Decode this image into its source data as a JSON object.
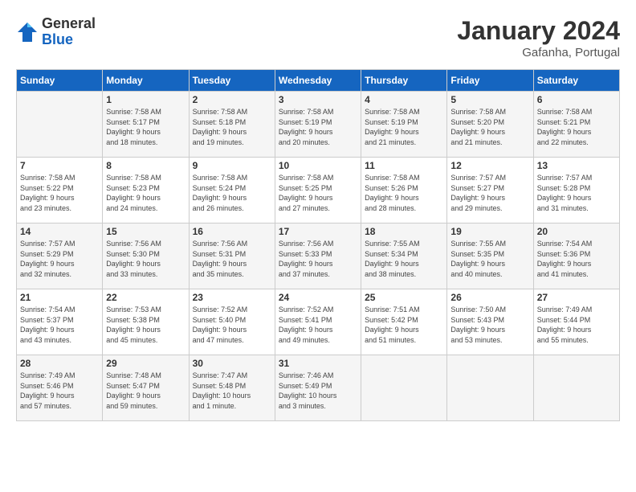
{
  "header": {
    "logo": {
      "line1": "General",
      "line2": "Blue"
    },
    "title": "January 2024",
    "location": "Gafanha, Portugal"
  },
  "weekdays": [
    "Sunday",
    "Monday",
    "Tuesday",
    "Wednesday",
    "Thursday",
    "Friday",
    "Saturday"
  ],
  "weeks": [
    [
      {
        "day": "",
        "info": ""
      },
      {
        "day": "1",
        "info": "Sunrise: 7:58 AM\nSunset: 5:17 PM\nDaylight: 9 hours\nand 18 minutes."
      },
      {
        "day": "2",
        "info": "Sunrise: 7:58 AM\nSunset: 5:18 PM\nDaylight: 9 hours\nand 19 minutes."
      },
      {
        "day": "3",
        "info": "Sunrise: 7:58 AM\nSunset: 5:19 PM\nDaylight: 9 hours\nand 20 minutes."
      },
      {
        "day": "4",
        "info": "Sunrise: 7:58 AM\nSunset: 5:19 PM\nDaylight: 9 hours\nand 21 minutes."
      },
      {
        "day": "5",
        "info": "Sunrise: 7:58 AM\nSunset: 5:20 PM\nDaylight: 9 hours\nand 21 minutes."
      },
      {
        "day": "6",
        "info": "Sunrise: 7:58 AM\nSunset: 5:21 PM\nDaylight: 9 hours\nand 22 minutes."
      }
    ],
    [
      {
        "day": "7",
        "info": "Sunrise: 7:58 AM\nSunset: 5:22 PM\nDaylight: 9 hours\nand 23 minutes."
      },
      {
        "day": "8",
        "info": "Sunrise: 7:58 AM\nSunset: 5:23 PM\nDaylight: 9 hours\nand 24 minutes."
      },
      {
        "day": "9",
        "info": "Sunrise: 7:58 AM\nSunset: 5:24 PM\nDaylight: 9 hours\nand 26 minutes."
      },
      {
        "day": "10",
        "info": "Sunrise: 7:58 AM\nSunset: 5:25 PM\nDaylight: 9 hours\nand 27 minutes."
      },
      {
        "day": "11",
        "info": "Sunrise: 7:58 AM\nSunset: 5:26 PM\nDaylight: 9 hours\nand 28 minutes."
      },
      {
        "day": "12",
        "info": "Sunrise: 7:57 AM\nSunset: 5:27 PM\nDaylight: 9 hours\nand 29 minutes."
      },
      {
        "day": "13",
        "info": "Sunrise: 7:57 AM\nSunset: 5:28 PM\nDaylight: 9 hours\nand 31 minutes."
      }
    ],
    [
      {
        "day": "14",
        "info": "Sunrise: 7:57 AM\nSunset: 5:29 PM\nDaylight: 9 hours\nand 32 minutes."
      },
      {
        "day": "15",
        "info": "Sunrise: 7:56 AM\nSunset: 5:30 PM\nDaylight: 9 hours\nand 33 minutes."
      },
      {
        "day": "16",
        "info": "Sunrise: 7:56 AM\nSunset: 5:31 PM\nDaylight: 9 hours\nand 35 minutes."
      },
      {
        "day": "17",
        "info": "Sunrise: 7:56 AM\nSunset: 5:33 PM\nDaylight: 9 hours\nand 37 minutes."
      },
      {
        "day": "18",
        "info": "Sunrise: 7:55 AM\nSunset: 5:34 PM\nDaylight: 9 hours\nand 38 minutes."
      },
      {
        "day": "19",
        "info": "Sunrise: 7:55 AM\nSunset: 5:35 PM\nDaylight: 9 hours\nand 40 minutes."
      },
      {
        "day": "20",
        "info": "Sunrise: 7:54 AM\nSunset: 5:36 PM\nDaylight: 9 hours\nand 41 minutes."
      }
    ],
    [
      {
        "day": "21",
        "info": "Sunrise: 7:54 AM\nSunset: 5:37 PM\nDaylight: 9 hours\nand 43 minutes."
      },
      {
        "day": "22",
        "info": "Sunrise: 7:53 AM\nSunset: 5:38 PM\nDaylight: 9 hours\nand 45 minutes."
      },
      {
        "day": "23",
        "info": "Sunrise: 7:52 AM\nSunset: 5:40 PM\nDaylight: 9 hours\nand 47 minutes."
      },
      {
        "day": "24",
        "info": "Sunrise: 7:52 AM\nSunset: 5:41 PM\nDaylight: 9 hours\nand 49 minutes."
      },
      {
        "day": "25",
        "info": "Sunrise: 7:51 AM\nSunset: 5:42 PM\nDaylight: 9 hours\nand 51 minutes."
      },
      {
        "day": "26",
        "info": "Sunrise: 7:50 AM\nSunset: 5:43 PM\nDaylight: 9 hours\nand 53 minutes."
      },
      {
        "day": "27",
        "info": "Sunrise: 7:49 AM\nSunset: 5:44 PM\nDaylight: 9 hours\nand 55 minutes."
      }
    ],
    [
      {
        "day": "28",
        "info": "Sunrise: 7:49 AM\nSunset: 5:46 PM\nDaylight: 9 hours\nand 57 minutes."
      },
      {
        "day": "29",
        "info": "Sunrise: 7:48 AM\nSunset: 5:47 PM\nDaylight: 9 hours\nand 59 minutes."
      },
      {
        "day": "30",
        "info": "Sunrise: 7:47 AM\nSunset: 5:48 PM\nDaylight: 10 hours\nand 1 minute."
      },
      {
        "day": "31",
        "info": "Sunrise: 7:46 AM\nSunset: 5:49 PM\nDaylight: 10 hours\nand 3 minutes."
      },
      {
        "day": "",
        "info": ""
      },
      {
        "day": "",
        "info": ""
      },
      {
        "day": "",
        "info": ""
      }
    ]
  ]
}
